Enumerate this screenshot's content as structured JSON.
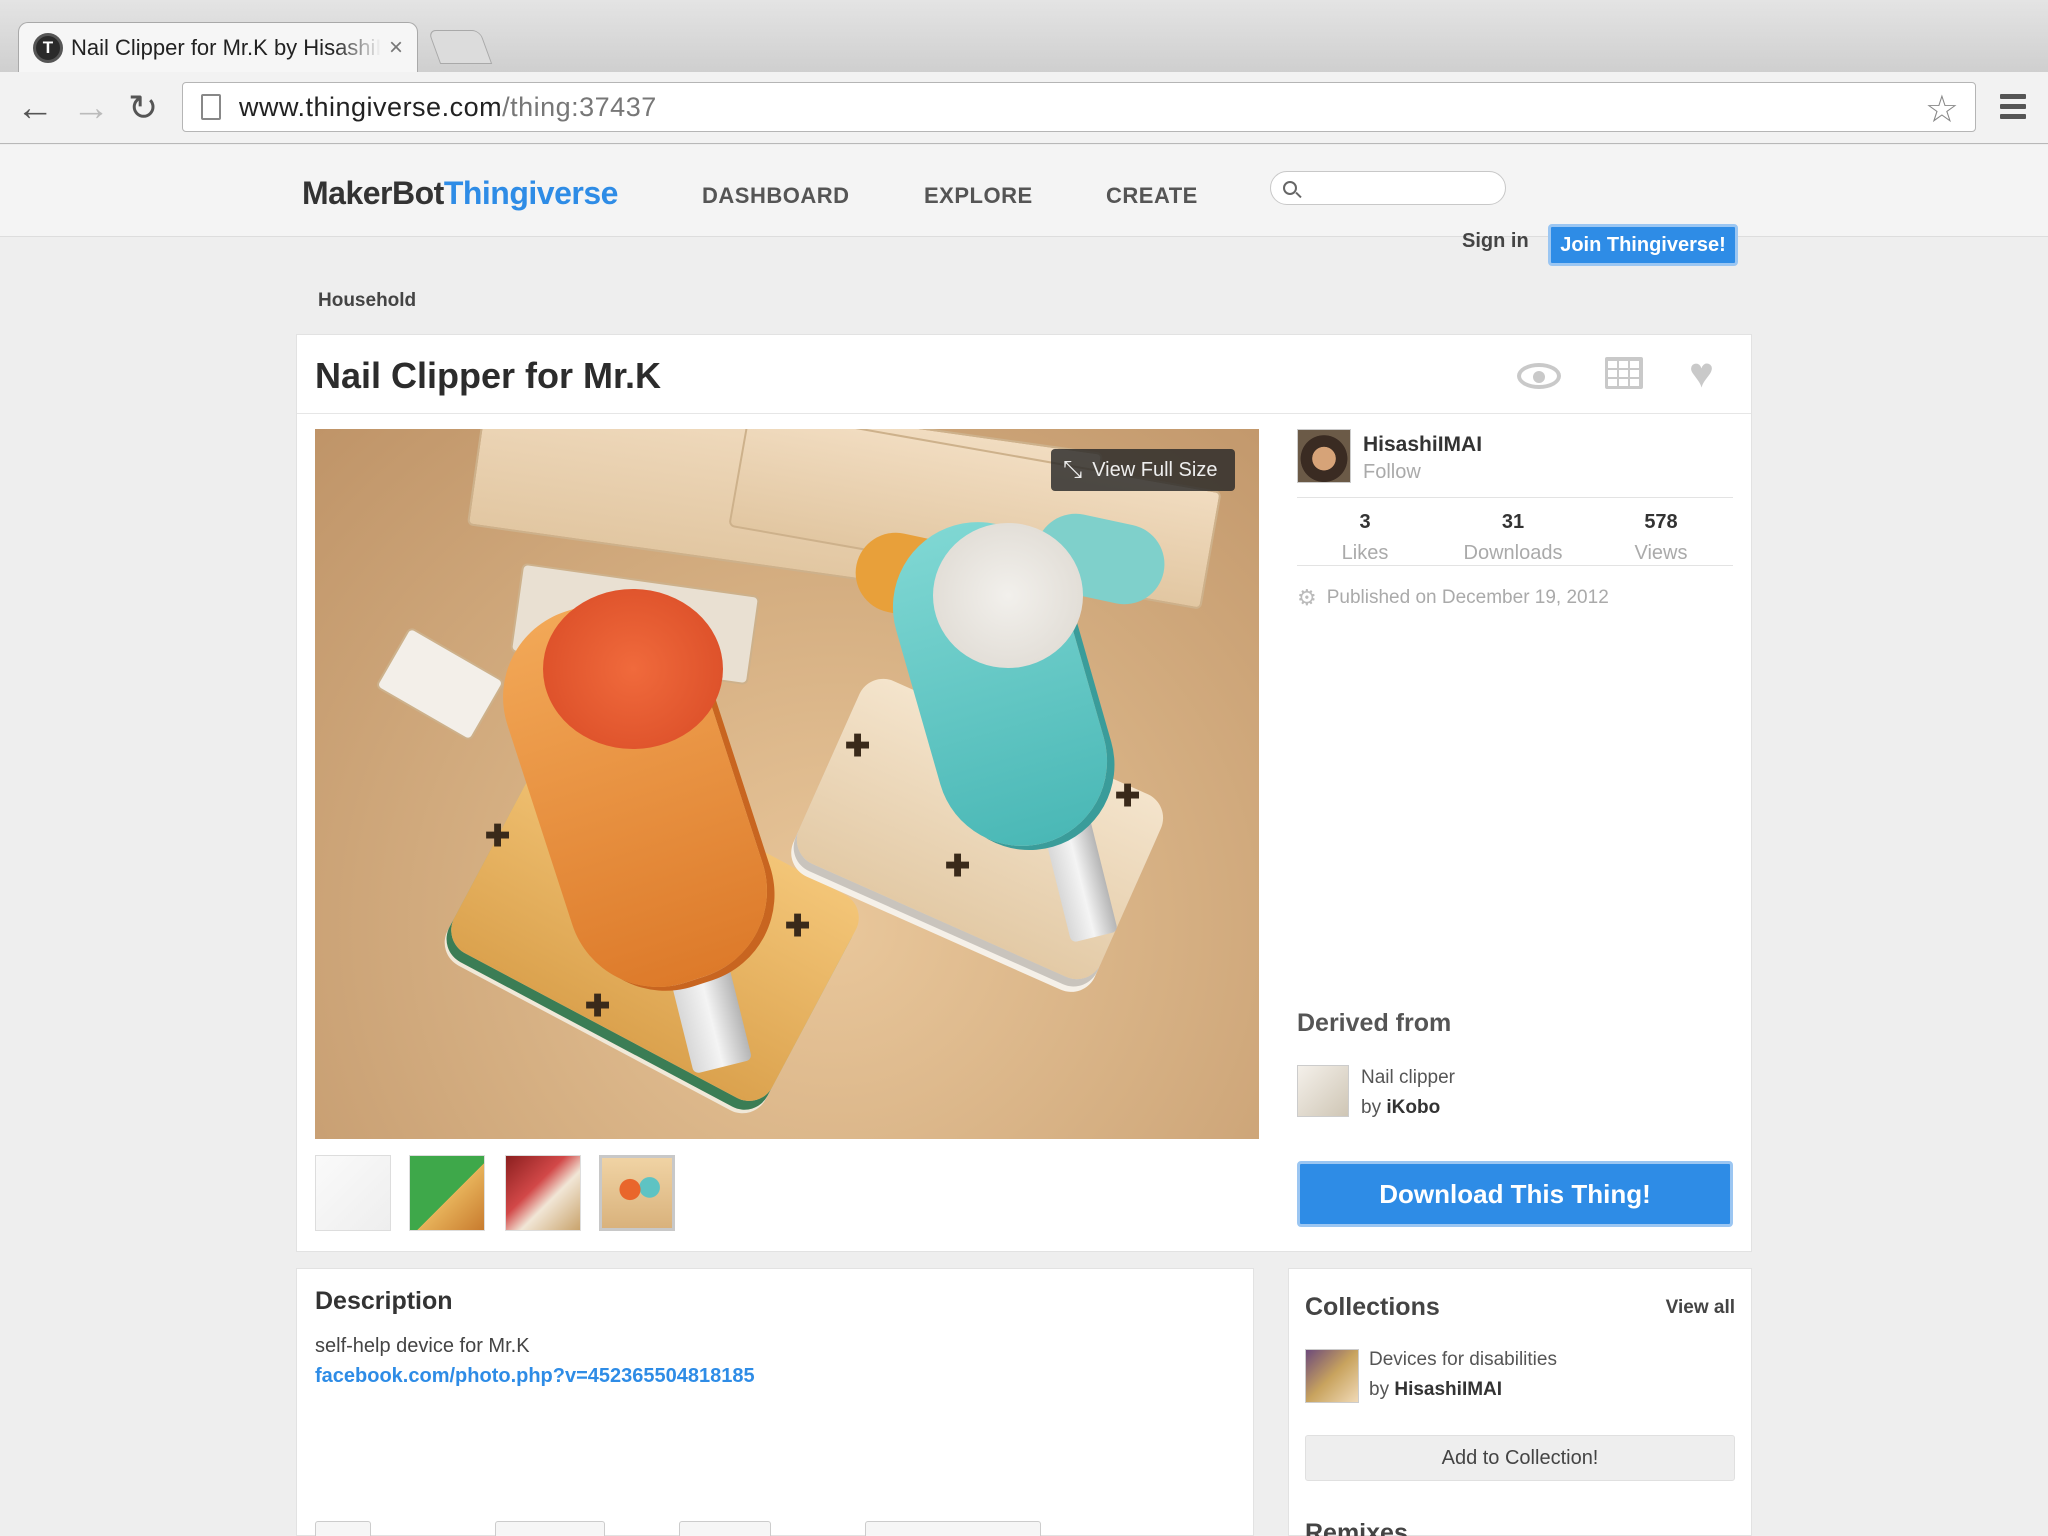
{
  "browser": {
    "tab_title": "Nail Clipper for Mr.K by HisashiIMAI",
    "tab_close": "×",
    "favicon_letter": "T",
    "url_host": "www.thingiverse.com",
    "url_path": "/thing:37437"
  },
  "site": {
    "logo_maker": "MakerBot",
    "logo_thingiverse": "Thingiverse",
    "nav": [
      "DASHBOARD",
      "EXPLORE",
      "CREATE"
    ],
    "search_placeholder": "",
    "signin": "Sign in",
    "join": "Join Thingiverse!"
  },
  "breadcrumb": "Household",
  "thing": {
    "title": "Nail Clipper for Mr.K",
    "view_full_size": "View Full Size",
    "author": "HisashiIMAI",
    "follow": "Follow",
    "stats": [
      {
        "num": "3",
        "label": "Likes"
      },
      {
        "num": "31",
        "label": "Downloads"
      },
      {
        "num": "578",
        "label": "Views"
      }
    ],
    "published": "Published on December 19, 2012",
    "derived_title": "Derived from",
    "derived_name": "Nail clipper",
    "derived_by_prefix": "by",
    "derived_by": "iKobo",
    "download": "Download This Thing!"
  },
  "description": {
    "title": "Description",
    "text": "self-help device for Mr.K",
    "link": "facebook.com/photo.php?v=452365504818185"
  },
  "collections": {
    "title": "Collections",
    "view_all": "View all",
    "item_name": "Devices for disabilities",
    "item_by_prefix": "by",
    "item_by": "HisashiIMAI",
    "add_button": "Add to Collection!",
    "remixes_title": "Remixes"
  },
  "colors": {
    "accent": "#2e8ce6"
  }
}
